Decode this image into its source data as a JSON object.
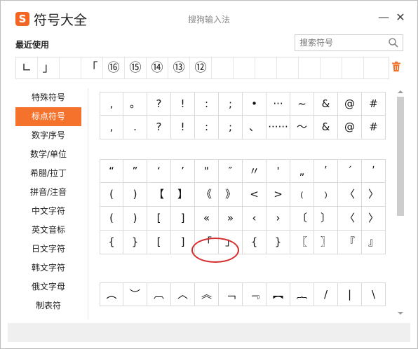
{
  "window": {
    "app_name": "符号大全",
    "logo": "S",
    "center_title": "搜狗输入法",
    "minimize_label": "—",
    "close_label": "✕"
  },
  "recent": {
    "label": "最近使用",
    "items": [
      "∟",
      "」",
      "",
      "「",
      "⑯",
      "⑮",
      "⑭",
      "⑬",
      "⑫",
      "",
      "",
      "",
      "",
      "",
      "",
      "",
      ""
    ]
  },
  "search": {
    "placeholder": "搜索符号"
  },
  "sidebar": {
    "items": [
      "特殊符号",
      "标点符号",
      "数字序号",
      "数学/单位",
      "希腊/拉丁",
      "拼音/注音",
      "中文字符",
      "英文音标",
      "日文字符",
      "韩文字符",
      "俄文字母",
      "制表符"
    ],
    "active_index": 1
  },
  "grid": {
    "blocks": [
      [
        [
          ",",
          "。",
          "?",
          "!",
          ":",
          ";",
          "•",
          "···",
          "~",
          "&",
          "@",
          "#"
        ],
        [
          ",",
          ".",
          "?",
          "!",
          ":",
          ";",
          "、",
          "······",
          "～",
          "&",
          "@",
          "#"
        ]
      ],
      [
        [
          "“",
          "”",
          "‘",
          "’",
          "\"",
          "″",
          "〃",
          "'",
          "„",
          "ʹ",
          "´",
          "ʹ"
        ],
        [
          "(",
          ")",
          "【",
          "】",
          "《",
          "》",
          "<",
          ">",
          "﹙",
          "﹚",
          "〈",
          "〉"
        ],
        [
          "(",
          ")",
          "[",
          "]",
          "«",
          "»",
          "‹",
          "›",
          "〔",
          "〕",
          "〈",
          "〉"
        ],
        [
          "{",
          "}",
          "[",
          "]",
          "「",
          "」",
          "{",
          "}",
          "〖",
          "〗",
          "『",
          "』"
        ]
      ],
      [
        [
          "︵",
          "︶",
          "︹",
          "︿",
          "︽",
          "﹁",
          "﹃",
          "︻",
          "︷",
          "/",
          "|",
          "\\"
        ]
      ]
    ]
  },
  "colors": {
    "accent": "#f5722c",
    "highlight_circle": "#d62a2a"
  }
}
